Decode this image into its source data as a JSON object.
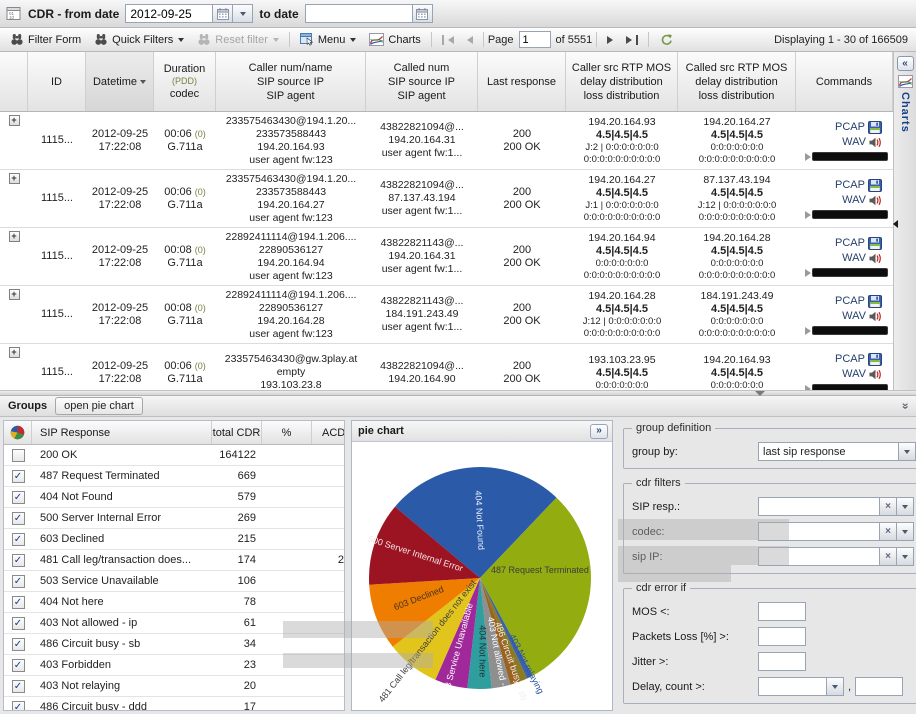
{
  "titlebar": {
    "title": "CDR - from date",
    "from_date": "2012-09-25",
    "to_date_label": "to date",
    "to_date": ""
  },
  "toolbar": {
    "filter_form": "Filter Form",
    "quick_filters": "Quick Filters",
    "reset_filter": "Reset filter",
    "menu": "Menu",
    "charts": "Charts",
    "page_label": "Page",
    "page_value": "1",
    "page_of": "of 5551",
    "displaying": "Displaying 1 - 30 of 166509"
  },
  "side_strip": {
    "collapse": "«",
    "label": "Charts"
  },
  "grid": {
    "pcap_label": "PCAP",
    "wav_label": "WAV",
    "columns": [
      {
        "lines": []
      },
      {
        "lines": [
          "ID"
        ]
      },
      {
        "lines": [
          "Datetime"
        ],
        "sorted": true
      },
      {
        "lines": [
          "Duration",
          "(PDD)",
          "codec"
        ]
      },
      {
        "lines": [
          "Caller num/name",
          "SIP source IP",
          "SIP agent"
        ]
      },
      {
        "lines": [
          "Called num",
          "SIP source IP",
          "SIP agent"
        ]
      },
      {
        "lines": [
          "Last response"
        ]
      },
      {
        "lines": [
          "Caller src RTP MOS",
          "delay distribution",
          "loss distribution"
        ]
      },
      {
        "lines": [
          "Called src RTP MOS",
          "delay distribution",
          "loss distribution"
        ]
      },
      {
        "lines": [
          "Commands"
        ]
      }
    ],
    "rows": [
      {
        "id": "1115...",
        "date": "2012-09-25",
        "time": "17:22:08",
        "dur": "00:06",
        "pdd": "(0)",
        "codec": "G.711a",
        "caller": [
          "233575463430@194.1.20...",
          "233573588443",
          "194.20.164.93",
          "user agent fw:123"
        ],
        "called": [
          "43822821094@...",
          "194.20.164.31",
          "user agent fw:1..."
        ],
        "resp": [
          "200",
          "200 OK"
        ],
        "caller_rtp": [
          "194.20.164.93",
          "4.5|4.5|4.5",
          "J:2 | 0:0:0:0:0:0:0",
          "0:0:0:0:0:0:0:0:0:0"
        ],
        "called_rtp": [
          "194.20.164.27",
          "4.5|4.5|4.5",
          "0:0:0:0:0:0:0",
          "0:0:0:0:0:0:0:0:0:0"
        ]
      },
      {
        "id": "1115...",
        "date": "2012-09-25",
        "time": "17:22:08",
        "dur": "00:06",
        "pdd": "(0)",
        "codec": "G.711a",
        "caller": [
          "233575463430@194.1.20...",
          "233573588443",
          "194.20.164.27",
          "user agent fw:123"
        ],
        "called": [
          "43822821094@...",
          "87.137.43.194",
          "user agent fw:1..."
        ],
        "resp": [
          "200",
          "200 OK"
        ],
        "caller_rtp": [
          "194.20.164.27",
          "4.5|4.5|4.5",
          "J:1 | 0:0:0:0:0:0:0",
          "0:0:0:0:0:0:0:0:0:0"
        ],
        "called_rtp": [
          "87.137.43.194",
          "4.5|4.5|4.5",
          "J:12 | 0:0:0:0:0:0:0",
          "0:0:0:0:0:0:0:0:0:0"
        ]
      },
      {
        "id": "1115...",
        "date": "2012-09-25",
        "time": "17:22:08",
        "dur": "00:08",
        "pdd": "(0)",
        "codec": "G.711a",
        "caller": [
          "22892411114@194.1.206....",
          "22890536127",
          "194.20.164.94",
          "user agent fw:123"
        ],
        "called": [
          "43822821143@...",
          "194.20.164.31",
          "user agent fw:1..."
        ],
        "resp": [
          "200",
          "200 OK"
        ],
        "caller_rtp": [
          "194.20.164.94",
          "4.5|4.5|4.5",
          "0:0:0:0:0:0:0",
          "0:0:0:0:0:0:0:0:0:0"
        ],
        "called_rtp": [
          "194.20.164.28",
          "4.5|4.5|4.5",
          "0:0:0:0:0:0:0",
          "0:0:0:0:0:0:0:0:0:0"
        ]
      },
      {
        "id": "1115...",
        "date": "2012-09-25",
        "time": "17:22:08",
        "dur": "00:08",
        "pdd": "(0)",
        "codec": "G.711a",
        "caller": [
          "22892411114@194.1.206....",
          "22890536127",
          "194.20.164.28",
          "user agent fw:123"
        ],
        "called": [
          "43822821143@...",
          "184.191.243.49",
          "user agent fw:1..."
        ],
        "resp": [
          "200",
          "200 OK"
        ],
        "caller_rtp": [
          "194.20.164.28",
          "4.5|4.5|4.5",
          "J:12 | 0:0:0:0:0:0:0",
          "0:0:0:0:0:0:0:0:0:0"
        ],
        "called_rtp": [
          "184.191.243.49",
          "4.5|4.5|4.5",
          "0:0:0:0:0:0:0",
          "0:0:0:0:0:0:0:0:0:0"
        ]
      },
      {
        "id": "1115...",
        "date": "2012-09-25",
        "time": "17:22:08",
        "dur": "00:06",
        "pdd": "(0)",
        "codec": "G.711a",
        "caller": [
          "233575463430@gw.3play.at",
          "empty",
          "193.103.23.8"
        ],
        "called": [
          "43822821094@...",
          "194.20.164.90"
        ],
        "resp": [
          "200",
          "200 OK"
        ],
        "caller_rtp": [
          "193.103.23.95",
          "4.5|4.5|4.5",
          "0:0:0:0:0:0:0"
        ],
        "called_rtp": [
          "194.20.164.93",
          "4.5|4.5|4.5",
          "0:0:0:0:0:0:0"
        ]
      }
    ]
  },
  "groups": {
    "title": "Groups",
    "open_pie_label": "open pie chart",
    "collapse": "«"
  },
  "sip_table": {
    "headers": {
      "response": "SIP Response",
      "total": "total CDR",
      "pct": "%",
      "clipped": "ACD"
    },
    "rows": [
      {
        "checked": false,
        "response": "200 OK",
        "total": "164122",
        "extra": ""
      },
      {
        "checked": true,
        "response": "487 Request Terminated",
        "total": "669",
        "extra": ""
      },
      {
        "checked": true,
        "response": "404 Not Found",
        "total": "579",
        "extra": ""
      },
      {
        "checked": true,
        "response": "500 Server Internal Error",
        "total": "269",
        "extra": ""
      },
      {
        "checked": true,
        "response": "603 Declined",
        "total": "215",
        "extra": ""
      },
      {
        "checked": true,
        "response": "481 Call leg/transaction does...",
        "total": "174",
        "extra": "2"
      },
      {
        "checked": true,
        "response": "503 Service Unavailable",
        "total": "106",
        "extra": ""
      },
      {
        "checked": true,
        "response": "404 Not here",
        "total": "78",
        "extra": ""
      },
      {
        "checked": true,
        "response": "403 Not allowed - ip",
        "total": "61",
        "extra": ""
      },
      {
        "checked": true,
        "response": "486 Circuit busy - sb",
        "total": "34",
        "extra": ""
      },
      {
        "checked": true,
        "response": "403 Forbidden",
        "total": "23",
        "extra": ""
      },
      {
        "checked": true,
        "response": "403 Not relaying",
        "total": "20",
        "extra": ""
      },
      {
        "checked": true,
        "response": "486 Circuit busy - ddd",
        "total": "17",
        "extra": ""
      }
    ]
  },
  "pie_panel": {
    "title": "pie chart",
    "expand_button": "»"
  },
  "chart_data": {
    "type": "pie",
    "title": "pie chart",
    "start_angle": 310,
    "legend_position": "none",
    "slices": [
      {
        "label": "404 Not Found",
        "value": 579,
        "color": "#2a5aa8",
        "label_color": "#e8eef8",
        "label_r": 0.52,
        "label_rot": 87,
        "show_label": true
      },
      {
        "label": "487 Request Terminated",
        "value": 669,
        "color": "#93ac10",
        "label_color": "#3c3c3c",
        "horizontal": true,
        "show_label": true
      },
      {
        "label": "403 Not relaying",
        "value": 20,
        "color": "#3a62ad",
        "label_color": "#2a52a0",
        "label_r": 0.88,
        "label_rot": 63,
        "show_label": true
      },
      {
        "label": "403 Forbidden",
        "value": 23,
        "color": "#8a7a22",
        "label_color": "#ffffff",
        "label_r": 0.8,
        "label_rot": 67,
        "show_label": false
      },
      {
        "label": "486 Circuit busy - sb",
        "value": 34,
        "color": "#9a6320",
        "label_color": "#efefef",
        "label_r": 0.8,
        "label_rot": 71,
        "show_label": true
      },
      {
        "label": "403 Not allowed - ip",
        "value": 61,
        "color": "#8f8f8f",
        "label_color": "#ffffff",
        "label_r": 0.72,
        "label_rot": 79,
        "show_label": true
      },
      {
        "label": "404 Not here",
        "value": 78,
        "color": "#2f9e9e",
        "label_color": "#223333",
        "label_r": 0.66,
        "label_rot": 90,
        "show_label": true
      },
      {
        "label": "503 Service Unavailable",
        "value": 106,
        "color": "#a1289a",
        "label_color": "#ffffff",
        "label_r": 0.68,
        "label_rot": -75,
        "show_label": true
      },
      {
        "label": "481 Call leg/transaction does not exist",
        "value": 174,
        "color": "#e2c51c",
        "label_color": "#3a3a3a",
        "label_r": 0.74,
        "label_rot": -52,
        "show_label": true
      },
      {
        "label": "603 Declined",
        "value": 215,
        "color": "#ef7d00",
        "label_color": "#443322",
        "label_r": 0.58,
        "label_rot": -21,
        "show_label": true
      },
      {
        "label": "500 Server Internal Error",
        "value": 269,
        "color": "#9c1322",
        "label_color": "#f3e6e6",
        "label_r": 0.62,
        "label_rot": 18,
        "show_label": true
      }
    ]
  },
  "form": {
    "group_definition": {
      "legend": "group definition",
      "group_by_label": "group by:",
      "group_by_value": "last sip response"
    },
    "cdr_filters": {
      "legend": "cdr filters",
      "rows": [
        {
          "label": "SIP resp.:",
          "value": ""
        },
        {
          "label": "codec:",
          "value": ""
        },
        {
          "label": "sip IP:",
          "value": ""
        }
      ]
    },
    "cdr_error": {
      "legend": "cdr error if",
      "rows": [
        {
          "label": "MOS <:",
          "value": ""
        },
        {
          "label": "Packets Loss [%] >:",
          "value": ""
        },
        {
          "label": "Jitter >:",
          "value": ""
        }
      ],
      "delay_label": "Delay, count >:",
      "delay_value": "",
      "comma": ",",
      "delay_count_value": ""
    }
  }
}
